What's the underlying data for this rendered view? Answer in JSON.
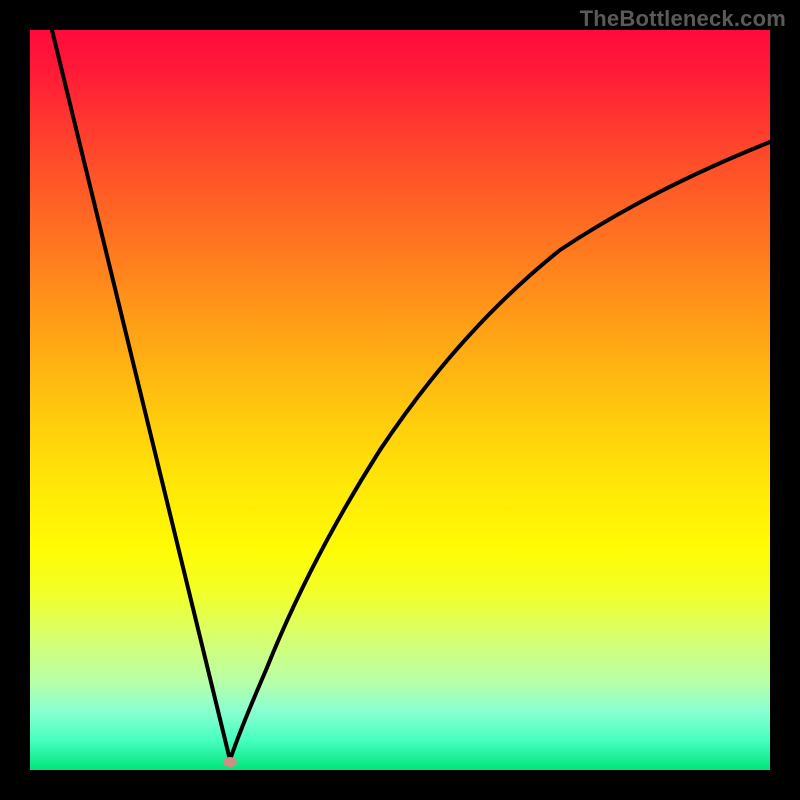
{
  "attribution": "TheBottleneck.com",
  "chart_data": {
    "type": "line",
    "title": "",
    "xlabel": "",
    "ylabel": "",
    "xlim": [
      0,
      100
    ],
    "ylim": [
      0,
      100
    ],
    "minimum_marker": {
      "x": 27,
      "y": 1
    },
    "series": [
      {
        "name": "left-branch",
        "x": [
          3,
          6,
          9,
          12,
          15,
          18,
          21,
          24,
          25.5,
          27
        ],
        "values": [
          100,
          88,
          75,
          63,
          50,
          38,
          25,
          13,
          6,
          1
        ]
      },
      {
        "name": "right-branch",
        "x": [
          27,
          28,
          30,
          33,
          37,
          42,
          48,
          55,
          63,
          72,
          82,
          92,
          100
        ],
        "values": [
          1,
          6,
          16,
          28,
          40,
          50,
          58,
          65,
          71,
          76,
          80,
          83,
          85
        ]
      }
    ],
    "background_gradient": {
      "top": "#ff0a3c",
      "mid": "#ffd00c",
      "bottom": "#00e57a"
    },
    "curve_color": "#000000",
    "marker_color": "#cf8f84"
  }
}
